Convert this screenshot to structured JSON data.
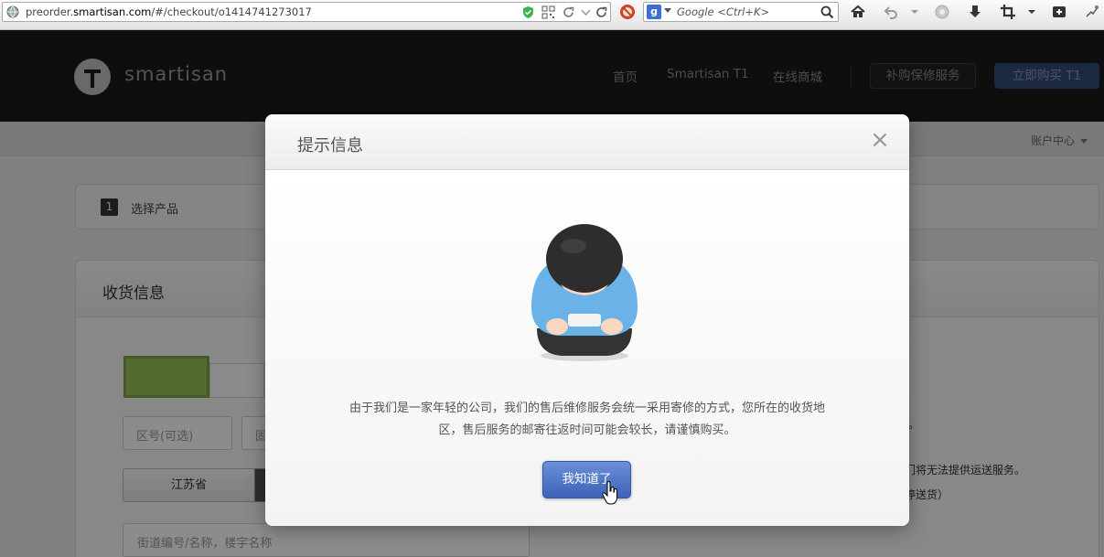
{
  "browser": {
    "url_prefix": "preorder.",
    "url_domain": "smartisan.com",
    "url_path": "/#/checkout/o1414741273017",
    "search_engine_icon": "g",
    "search_placeholder": "Google <Ctrl+K>"
  },
  "site": {
    "logo_text": "smartisan",
    "nav": [
      "首页",
      "Smartisan T1",
      "在线商城"
    ],
    "service_button": "补购保修服务",
    "buy_button": "立即购买 T1",
    "account_label": "账户中心"
  },
  "checkout": {
    "step_number": "1",
    "step_label": "选择产品",
    "section_title": "收货信息",
    "area_code_placeholder": "区号(可选)",
    "phone_placeholder": "固",
    "province": "江苏省",
    "street_placeholder": "街道编号/名称，楼宇名称",
    "note_1": "。",
    "note_2": "门将无法提供运送服务。",
    "note_3": "停送货）"
  },
  "modal": {
    "title": "提示信息",
    "close_icon": "close-icon",
    "message": "由于我们是一家年轻的公司，我们的售后维修服务会统一采用寄修的方式，您所在的收货地区，售后服务的邮寄往返时间可能会较长，请谨慎购买。",
    "ok_button": "我知道了"
  },
  "colors": {
    "header_bg": "#1a1a1a",
    "buy_button": "#344c78",
    "ok_button": "#4f74c8",
    "highlight_box": "#99c15a"
  }
}
